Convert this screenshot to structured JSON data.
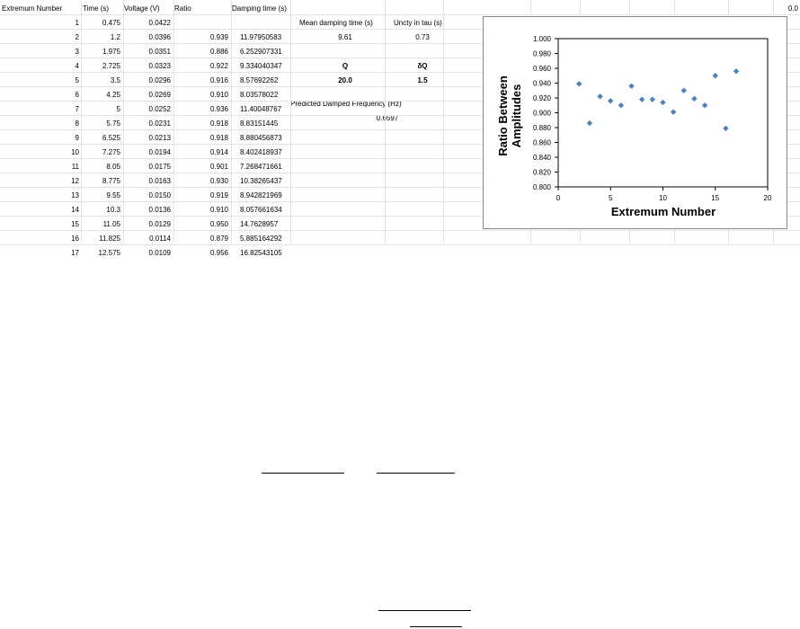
{
  "headers": {
    "extremum": "Extremum Number",
    "time": "Time (s)",
    "voltage": "Voltage (V)",
    "ratio": "Ratio",
    "damping": "Damping time (s)",
    "right_edge": "0.0"
  },
  "rows": [
    {
      "n": "1",
      "time": "0.475",
      "voltage": "0.0422",
      "ratio": "",
      "damping": ""
    },
    {
      "n": "2",
      "time": "1.2",
      "voltage": "0.0396",
      "ratio": "0.939",
      "damping": "11.97950583"
    },
    {
      "n": "3",
      "time": "1.975",
      "voltage": "0.0351",
      "ratio": "0.886",
      "damping": "6.252907331"
    },
    {
      "n": "4",
      "time": "2.725",
      "voltage": "0.0323",
      "ratio": "0.922",
      "damping": "9.334040347"
    },
    {
      "n": "5",
      "time": "3.5",
      "voltage": "0.0296",
      "ratio": "0.916",
      "damping": "8.57692262"
    },
    {
      "n": "6",
      "time": "4.25",
      "voltage": "0.0269",
      "ratio": "0.910",
      "damping": "8.03578022"
    },
    {
      "n": "7",
      "time": "5",
      "voltage": "0.0252",
      "ratio": "0.936",
      "damping": "11.40048767"
    },
    {
      "n": "8",
      "time": "5.75",
      "voltage": "0.0231",
      "ratio": "0.918",
      "damping": "8.83151445"
    },
    {
      "n": "9",
      "time": "6.525",
      "voltage": "0.0213",
      "ratio": "0.918",
      "damping": "8.880456873"
    },
    {
      "n": "10",
      "time": "7.275",
      "voltage": "0.0194",
      "ratio": "0.914",
      "damping": "8.402418937"
    },
    {
      "n": "11",
      "time": "8.05",
      "voltage": "0.0175",
      "ratio": "0.901",
      "damping": "7.268471661"
    },
    {
      "n": "12",
      "time": "8.775",
      "voltage": "0.0163",
      "ratio": "0.930",
      "damping": "10.38265437"
    },
    {
      "n": "13",
      "time": "9.55",
      "voltage": "0.0150",
      "ratio": "0.919",
      "damping": "8.942821969"
    },
    {
      "n": "14",
      "time": "10.3",
      "voltage": "0.0136",
      "ratio": "0.910",
      "damping": "8.057661634"
    },
    {
      "n": "15",
      "time": "11.05",
      "voltage": "0.0129",
      "ratio": "0.950",
      "damping": "14.7628957"
    },
    {
      "n": "16",
      "time": "11.825",
      "voltage": "0.0114",
      "ratio": "0.879",
      "damping": "5.885164292"
    },
    {
      "n": "17",
      "time": "12.575",
      "voltage": "0.0109",
      "ratio": "0.956",
      "damping": "16.82543105"
    }
  ],
  "summary": {
    "mean_damping_label": "Mean damping time (s)",
    "mean_damping_value": "9.61",
    "uncty_label": "Uncty in tau (s)",
    "uncty_value": "0.73",
    "q_label": "Q",
    "q_value": "20.0",
    "dq_label": "δQ",
    "dq_value": "1.5",
    "freq_label": "Predicted Damped Frequency (Hz)",
    "freq_value": "0.6597"
  },
  "chart_data": {
    "type": "scatter",
    "title": "",
    "xlabel": "Extremum Number",
    "ylabel": "Ratio Between Amplitudes",
    "xlim": [
      0,
      20
    ],
    "ylim": [
      0.8,
      1.0
    ],
    "x_ticks": [
      "0",
      "5",
      "10",
      "15",
      "20"
    ],
    "y_ticks": [
      "0.800",
      "0.820",
      "0.840",
      "0.860",
      "0.880",
      "0.900",
      "0.920",
      "0.940",
      "0.960",
      "0.980",
      "1.000"
    ],
    "marker_color": "#4f81bd",
    "grid": false,
    "series": [
      {
        "x": [
          2,
          3,
          4,
          5,
          6,
          7,
          8,
          9,
          10,
          11,
          12,
          13,
          14,
          15,
          16,
          17
        ],
        "y": [
          0.939,
          0.886,
          0.922,
          0.916,
          0.91,
          0.936,
          0.918,
          0.918,
          0.914,
          0.901,
          0.93,
          0.919,
          0.91,
          0.95,
          0.879,
          0.956
        ]
      }
    ]
  }
}
